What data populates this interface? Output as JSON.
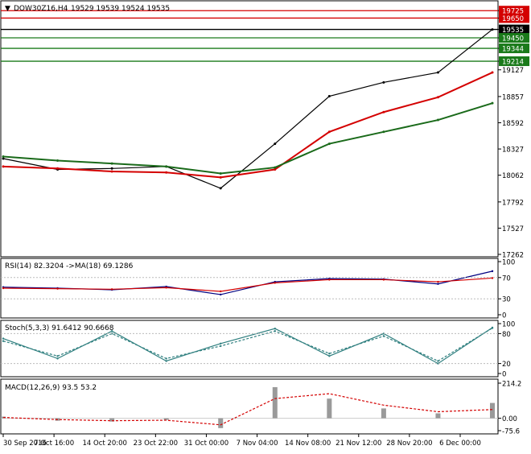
{
  "panels": {
    "price": {
      "symbol": "DOW30Z16,H4",
      "ohlc": "19529 19539 19524 19535",
      "axis": [
        "19725",
        "19650",
        "19535",
        "19450",
        "19344",
        "19214",
        "19127",
        "18857",
        "18592",
        "18327",
        "18062",
        "17792",
        "17527",
        "17262"
      ],
      "levels": [
        {
          "label": "19725",
          "price": 19725,
          "color": "#d40000"
        },
        {
          "label": "19650",
          "price": 19650,
          "color": "#d40000"
        },
        {
          "label": "19535",
          "price": 19535,
          "color": "#000000"
        },
        {
          "label": "19450",
          "price": 19450,
          "color": "#1a7a1a"
        },
        {
          "label": "19344",
          "price": 19344,
          "color": "#1a7a1a"
        },
        {
          "label": "19214",
          "price": 19214,
          "color": "#1a7a1a"
        }
      ]
    },
    "rsi": {
      "title": "RSI(14) 82.3204  ->MA(18) 69.1286",
      "axis": [
        "100",
        "70",
        "30",
        "0"
      ]
    },
    "stoch": {
      "title": "Stoch(5,3,3) 91.6412 90.6668",
      "axis": [
        "100",
        "80",
        "20",
        "0"
      ]
    },
    "macd": {
      "title": "MACD(12,26,9) 93.5 53.2",
      "axis": [
        "214.2",
        "0.00",
        "-75.6"
      ]
    }
  },
  "time_axis": [
    "30 Sep 2016",
    "7 Oct 16:00",
    "14 Oct 20:00",
    "23 Oct 22:00",
    "31 Oct 00:00",
    "7 Nov 04:00",
    "14 Nov 08:00",
    "21 Nov 12:00",
    "28 Nov 20:00",
    "6 Dec 00:00"
  ],
  "colors": {
    "price_line": "#000000",
    "ma_fast": "#d40000",
    "ma_slow": "#1a6a1a",
    "bands": "#2f4f4f",
    "rsi": "#000080",
    "rsi_ma": "#d40000",
    "stoch": "#2f7f7f",
    "macd_hist": "#9a9a9a",
    "macd_signal": "#d40000"
  },
  "chart_data": [
    {
      "type": "line",
      "title": "DOW30Z16,H4",
      "x": [
        "30 Sep 2016",
        "7 Oct 16:00",
        "14 Oct 20:00",
        "23 Oct 22:00",
        "31 Oct 00:00",
        "7 Nov 04:00",
        "14 Nov 08:00",
        "21 Nov 12:00",
        "28 Nov 20:00",
        "6 Dec 00:00"
      ],
      "series": [
        {
          "values": [
            18230,
            18120,
            18130,
            18150,
            17930,
            18380,
            18860,
            19000,
            19100,
            19535
          ]
        },
        {
          "values": [
            18150,
            18130,
            18100,
            18090,
            18040,
            18120,
            18500,
            18700,
            18850,
            19100
          ]
        },
        {
          "values": [
            18250,
            18210,
            18180,
            18150,
            18080,
            18140,
            18380,
            18500,
            18620,
            18790
          ]
        }
      ],
      "ylim": [
        17262,
        19800
      ]
    },
    {
      "type": "line",
      "title": "RSI(14) 82.3204  ->MA(18) 69.1286",
      "x": [
        "30 Sep 2016",
        "7 Oct 16:00",
        "14 Oct 20:00",
        "23 Oct 22:00",
        "31 Oct 00:00",
        "7 Nov 04:00",
        "14 Nov 08:00",
        "21 Nov 12:00",
        "28 Nov 20:00",
        "6 Dec 00:00"
      ],
      "series": [
        {
          "values": [
            52,
            50,
            47,
            53,
            38,
            62,
            68,
            67,
            58,
            82
          ]
        },
        {
          "values": [
            50,
            49,
            48,
            51,
            44,
            60,
            66,
            66,
            62,
            69
          ]
        }
      ],
      "ylim": [
        0,
        100
      ]
    },
    {
      "type": "line",
      "title": "Stoch(5,3,3) 91.6412 90.6668",
      "x": [
        "30 Sep 2016",
        "7 Oct 16:00",
        "14 Oct 20:00",
        "23 Oct 22:00",
        "31 Oct 00:00",
        "7 Nov 04:00",
        "14 Nov 08:00",
        "21 Nov 12:00",
        "28 Nov 20:00",
        "6 Dec 00:00"
      ],
      "series": [
        {
          "values": [
            70,
            30,
            85,
            25,
            60,
            90,
            35,
            80,
            20,
            92
          ]
        },
        {
          "values": [
            65,
            35,
            80,
            30,
            55,
            85,
            40,
            75,
            25,
            91
          ]
        }
      ],
      "ylim": [
        0,
        100
      ]
    },
    {
      "type": "bar",
      "title": "MACD(12,26,9) 93.5 53.2",
      "x": [
        "30 Sep 2016",
        "7 Oct 16:00",
        "14 Oct 20:00",
        "23 Oct 22:00",
        "31 Oct 00:00",
        "7 Nov 04:00",
        "14 Nov 08:00",
        "21 Nov 12:00",
        "28 Nov 20:00",
        "6 Dec 00:00"
      ],
      "series": [
        {
          "values": [
            10,
            -15,
            -20,
            -10,
            -60,
            190,
            120,
            60,
            30,
            93.5
          ]
        },
        {
          "values": [
            5,
            -8,
            -15,
            -12,
            -40,
            120,
            150,
            80,
            40,
            53.2
          ]
        }
      ],
      "ylim": [
        -75.6,
        214.2
      ]
    }
  ]
}
